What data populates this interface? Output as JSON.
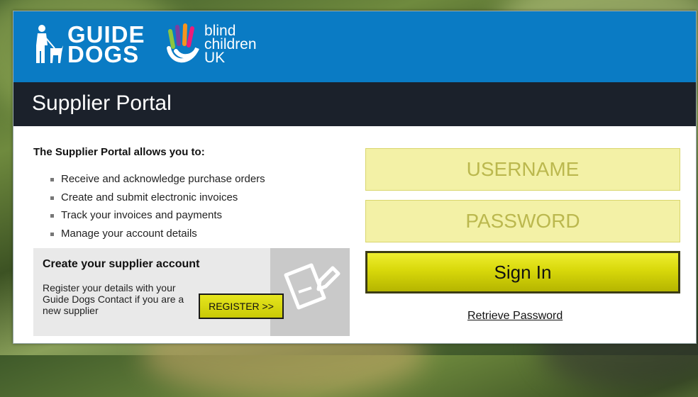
{
  "brand": {
    "guide_dogs_line1": "GUIDE",
    "guide_dogs_line2": "DOGS",
    "bcuk_line1": "blind",
    "bcuk_line2": "children",
    "bcuk_line3": "UK",
    "colors": {
      "blue": "#0a7bc4",
      "dark": "#1b212b"
    }
  },
  "title": "Supplier Portal",
  "intro": {
    "heading": "The Supplier Portal allows you to:",
    "features": [
      "Receive and acknowledge purchase orders",
      "Create and submit electronic invoices",
      "Track your invoices and payments",
      "Manage your account details"
    ]
  },
  "register": {
    "heading": "Create your supplier account",
    "body": "Register your details with your Guide Dogs Contact if you are a new supplier",
    "button_label": "REGISTER >>",
    "icon": "document-edit-icon"
  },
  "login": {
    "username_placeholder": "USERNAME",
    "password_placeholder": "PASSWORD",
    "signin_label": "Sign In",
    "retrieve_label": "Retrieve Password",
    "accent": "#d8d80a"
  }
}
